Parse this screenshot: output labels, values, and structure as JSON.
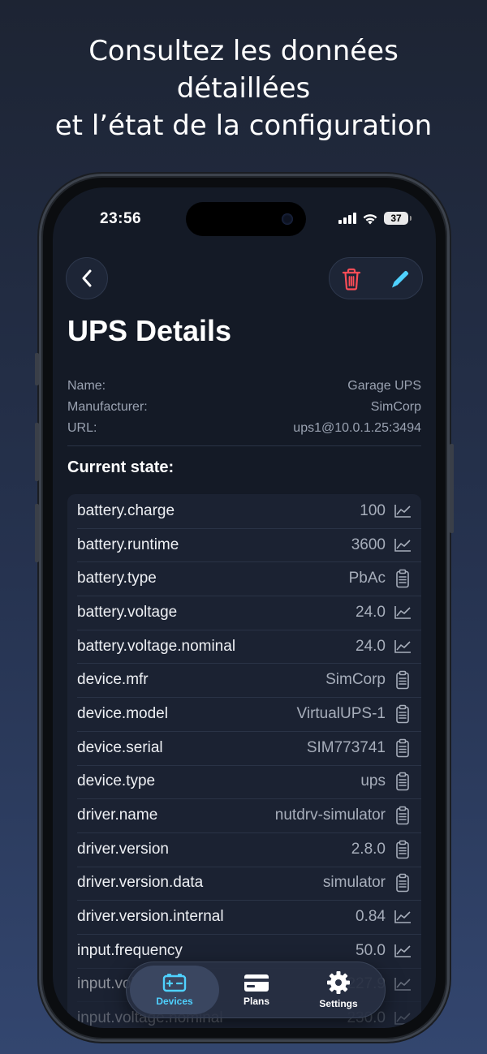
{
  "headline": [
    "Consultez les données",
    "détaillées",
    "et l’état de la configuration"
  ],
  "status_bar": {
    "time": "23:56",
    "battery": "37"
  },
  "page": {
    "title": "UPS Details"
  },
  "meta": [
    {
      "label": "Name:",
      "value": "Garage UPS"
    },
    {
      "label": "Manufacturer:",
      "value": "SimCorp"
    },
    {
      "label": "URL:",
      "value": "ups1@10.0.1.25:3494"
    }
  ],
  "section_title": "Current state:",
  "rows": [
    {
      "key": "battery.charge",
      "value": "100",
      "icon": "chart-icon"
    },
    {
      "key": "battery.runtime",
      "value": "3600",
      "icon": "chart-icon"
    },
    {
      "key": "battery.type",
      "value": "PbAc",
      "icon": "clipboard-icon"
    },
    {
      "key": "battery.voltage",
      "value": "24.0",
      "icon": "chart-icon"
    },
    {
      "key": "battery.voltage.nominal",
      "value": "24.0",
      "icon": "chart-icon"
    },
    {
      "key": "device.mfr",
      "value": "SimCorp",
      "icon": "clipboard-icon"
    },
    {
      "key": "device.model",
      "value": "VirtualUPS-1",
      "icon": "clipboard-icon"
    },
    {
      "key": "device.serial",
      "value": "SIM773741",
      "icon": "clipboard-icon"
    },
    {
      "key": "device.type",
      "value": "ups",
      "icon": "clipboard-icon"
    },
    {
      "key": "driver.name",
      "value": "nutdrv-simulator",
      "icon": "clipboard-icon"
    },
    {
      "key": "driver.version",
      "value": "2.8.0",
      "icon": "clipboard-icon"
    },
    {
      "key": "driver.version.data",
      "value": "simulator",
      "icon": "clipboard-icon"
    },
    {
      "key": "driver.version.internal",
      "value": "0.84",
      "icon": "chart-icon"
    },
    {
      "key": "input.frequency",
      "value": "50.0",
      "icon": "chart-icon"
    },
    {
      "key": "input.voltage",
      "value": "227.9",
      "icon": "chart-icon"
    },
    {
      "key": "input.voltage.nominal",
      "value": "230.0",
      "icon": "chart-icon"
    }
  ],
  "tabbar": {
    "tabs": [
      {
        "label": "Devices",
        "icon": "battery-icon",
        "active": true
      },
      {
        "label": "Plans",
        "icon": "card-icon",
        "active": false
      },
      {
        "label": "Settings",
        "icon": "gear-icon",
        "active": false
      }
    ]
  },
  "colors": {
    "accent": "#4fd1ff",
    "danger": "#ff4d57",
    "background": "#141a26"
  }
}
